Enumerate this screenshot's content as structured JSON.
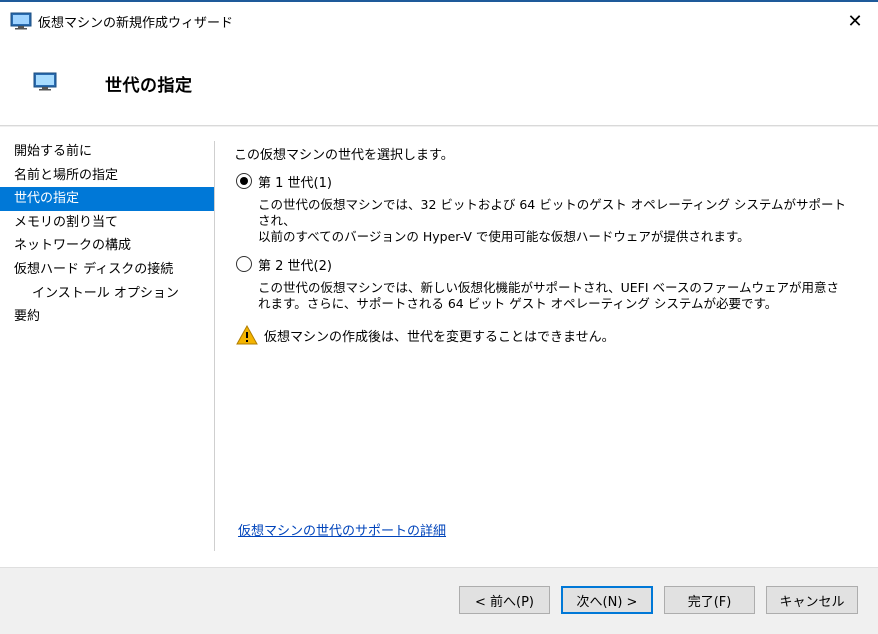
{
  "window": {
    "title": "仮想マシンの新規作成ウィザード",
    "close_symbol": "✕"
  },
  "header": {
    "title": "世代の指定"
  },
  "sidebar": {
    "items": [
      {
        "label": "開始する前に"
      },
      {
        "label": "名前と場所の指定"
      },
      {
        "label": "世代の指定"
      },
      {
        "label": "メモリの割り当て"
      },
      {
        "label": "ネットワークの構成"
      },
      {
        "label": "仮想ハード ディスクの接続"
      },
      {
        "label": "インストール オプション"
      },
      {
        "label": "要約"
      }
    ]
  },
  "main": {
    "instruction": "この仮想マシンの世代を選択します。",
    "gen1": {
      "label": "第 1 世代(1)",
      "checked": true,
      "desc_line1": "この世代の仮想マシンでは、32 ビットおよび 64 ビットのゲスト オペレーティング システムがサポートされ、",
      "desc_line2": "以前のすべてのバージョンの Hyper-V で使用可能な仮想ハードウェアが提供されます。"
    },
    "gen2": {
      "label": "第 2 世代(2)",
      "checked": false,
      "desc_line1": "この世代の仮想マシンでは、新しい仮想化機能がサポートされ、UEFI ベースのファームウェアが用意さ",
      "desc_line2": "れます。さらに、サポートされる 64 ビット ゲスト オペレーティング システムが必要です。"
    },
    "warning": "仮想マシンの作成後は、世代を変更することはできません。",
    "more_link": "仮想マシンの世代のサポートの詳細"
  },
  "footer": {
    "back_label": "< 前へ(P)",
    "next_label": "次へ(N) >",
    "finish_label": "完了(F)",
    "cancel_label": "キャンセル"
  },
  "colors": {
    "accent": "#0078d7",
    "link": "#0044bb",
    "warning": "#f4b400"
  }
}
